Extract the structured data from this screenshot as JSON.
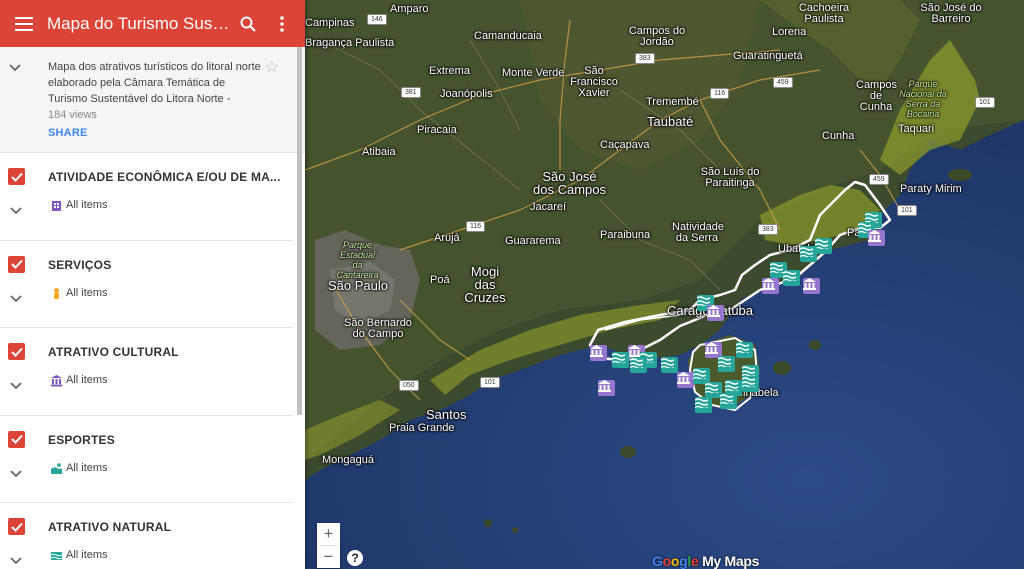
{
  "app": {
    "title": "Mapa do Turismo Sustentável do Litoral Norte",
    "title_display": "Mapa do Turismo Suste..."
  },
  "description": {
    "text": "Mapa dos atrativos turísticos do litoral norte elaborado pela Câmara Temática de Turismo Sustentável do Litora Norte -",
    "views": "184 views",
    "share_label": "SHARE"
  },
  "layers": [
    {
      "name": "ATIVIDADE ECONÔMICA E/OU DE MA...",
      "items_label": "All items",
      "icon": "building-icon",
      "color": "#7e57c2"
    },
    {
      "name": "SERVIÇOS",
      "items_label": "All items",
      "icon": "person-icon",
      "color": "#f9a825"
    },
    {
      "name": "ATRATIVO CULTURAL",
      "items_label": "All items",
      "icon": "museum-icon",
      "color": "#7e57c2"
    },
    {
      "name": "ESPORTES",
      "items_label": "All items",
      "icon": "swimmer-icon",
      "color": "#26a69a"
    },
    {
      "name": "ATRATIVO NATURAL",
      "items_label": "All items",
      "icon": "waves-icon",
      "color": "#26a69a"
    }
  ],
  "map": {
    "labels": {
      "campinas": "Campinas",
      "amparo": "Amparo",
      "braganca": "Bragança Paulista",
      "camanducaia": "Camanducaia",
      "campos_jordao": "Campos do Jordão",
      "cachoeira": "Cachoeira Paulista",
      "sao_jose_barreiro": "São José do Barreiro",
      "lorena": "Lorena",
      "guaratingueta": "Guaratinguetá",
      "extrema": "Extrema",
      "monte_verde": "Monte Verde",
      "sao_francisco_xavier": "São Francisco Xavier",
      "joanopolis": "Joanópolis",
      "tremembe": "Tremembé",
      "taubate": "Taubaté",
      "piracaia": "Piracaia",
      "atibaia": "Atibaia",
      "cacapava": "Caçapava",
      "cunha": "Cunha",
      "campos_cunha": "Campos de Cunha",
      "taquari": "Taquari",
      "parque_bocaina": "Parque Nacional da Serra da Bocaina",
      "sao_jose_campos": "São José dos Campos",
      "jacarei": "Jacareí",
      "sao_luiz": "São Luís do Paraitinga",
      "paraty_mirim": "Paraty Mirim",
      "aruja": "Arujá",
      "guararema": "Guararema",
      "paraibuna": "Paraibuna",
      "natividade": "Natividade da Serra",
      "parque_cantareira": "Parque Estadual da Cantareira",
      "mogi": "Mogi das Cruzes",
      "poa": "Poá",
      "sao_paulo": "São Paulo",
      "sao_bernardo": "São Bernardo do Campo",
      "santos": "Santos",
      "praia_grande": "Praia Grande",
      "mongagua": "Mongaguá",
      "ubatuba": "Ubatuba",
      "caraguatatuba": "Caraguatatuba",
      "ilhabela": "Ilhabela",
      "paraty": "Paraty"
    },
    "roads": [
      "146",
      "383",
      "381",
      "116",
      "459",
      "383",
      "116",
      "101",
      "101",
      "050",
      "101",
      "459"
    ],
    "zoom_in": "+",
    "zoom_out": "−",
    "help": "?",
    "attribution": "Google My Maps"
  },
  "colors": {
    "header": "#db4437",
    "accent": "#4285f4",
    "natural_marker": "#26a69a",
    "cultural_marker": "#9575cd"
  }
}
